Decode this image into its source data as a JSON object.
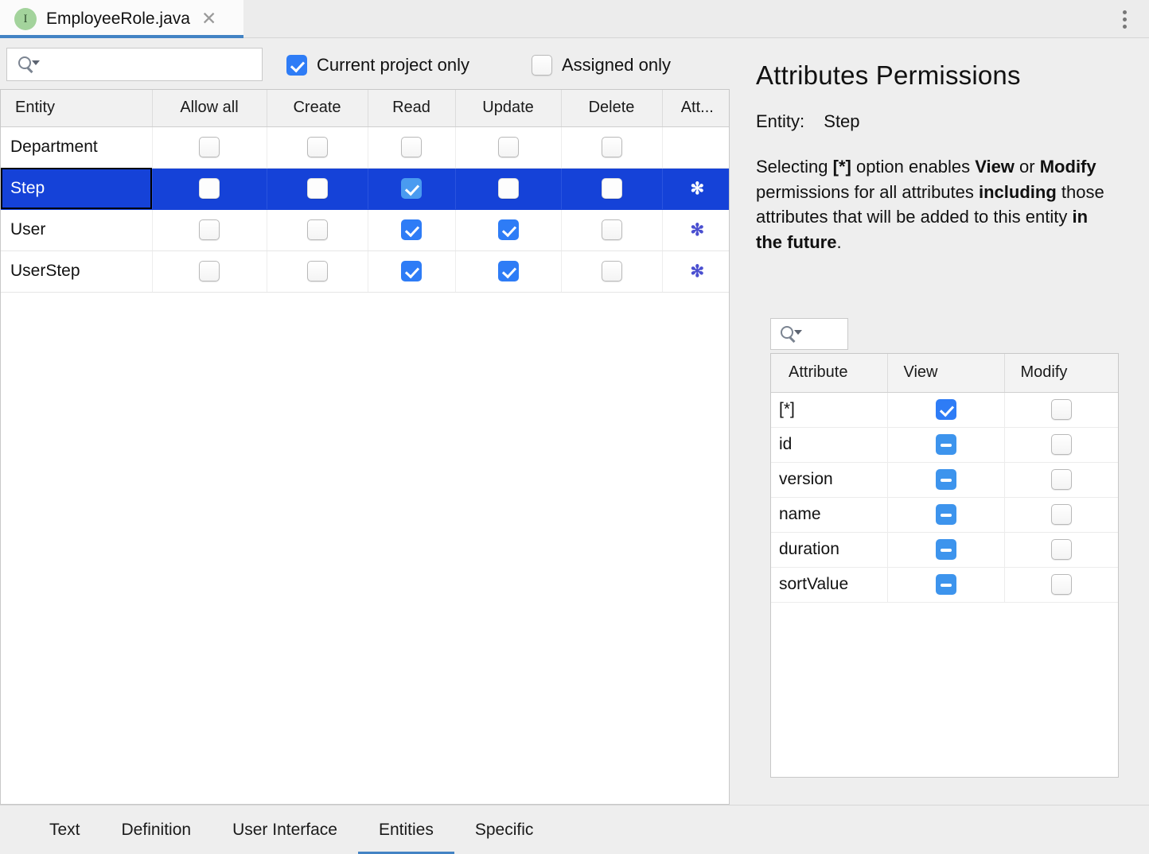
{
  "editor_tab": {
    "icon": "java-interface-icon",
    "filename": "EmployeeRole.java",
    "close": "✕"
  },
  "window_menu": {
    "icon": "more-vertical-icon"
  },
  "filters": {
    "search": {
      "placeholder": "",
      "value": "",
      "icon": "search-icon"
    },
    "current_project_only": {
      "label": "Current project only",
      "checked": true
    },
    "assigned_only": {
      "label": "Assigned only",
      "checked": false
    }
  },
  "entities_table": {
    "columns": [
      "Entity",
      "Allow all",
      "Create",
      "Read",
      "Update",
      "Delete",
      "Att..."
    ],
    "rows": [
      {
        "entity": "Department",
        "selected": false,
        "allow_all": "off",
        "create": "off",
        "read": "off",
        "update": "off",
        "delete": "off",
        "attributes": ""
      },
      {
        "entity": "Step",
        "selected": true,
        "allow_all": "off",
        "create": "off",
        "read": "on",
        "update": "off",
        "delete": "off",
        "attributes": "✻"
      },
      {
        "entity": "User",
        "selected": false,
        "allow_all": "off",
        "create": "off",
        "read": "on",
        "update": "on",
        "delete": "off",
        "attributes": "✻"
      },
      {
        "entity": "UserStep",
        "selected": false,
        "allow_all": "off",
        "create": "off",
        "read": "on",
        "update": "on",
        "delete": "off",
        "attributes": "✻"
      }
    ]
  },
  "attributes_panel": {
    "title": "Attributes Permissions",
    "entity_label": "Entity:",
    "entity_value": "Step",
    "description_parts": [
      {
        "text": "Selecting ",
        "bold": false
      },
      {
        "text": "[*]",
        "bold": true
      },
      {
        "text": " option enables ",
        "bold": false
      },
      {
        "text": "View",
        "bold": true
      },
      {
        "text": " or ",
        "bold": false
      },
      {
        "text": "Modify",
        "bold": true
      },
      {
        "text": " permissions for all attributes ",
        "bold": false
      },
      {
        "text": "including",
        "bold": true
      },
      {
        "text": " those attributes that will be added to this entity ",
        "bold": false
      },
      {
        "text": "in the future",
        "bold": true
      },
      {
        "text": ".",
        "bold": false
      }
    ],
    "search": {
      "placeholder": "",
      "value": "",
      "icon": "search-icon"
    },
    "columns": [
      "Attribute",
      "View",
      "Modify"
    ],
    "rows": [
      {
        "attribute": "[*]",
        "view": "on",
        "modify": "off"
      },
      {
        "attribute": "id",
        "view": "dash",
        "modify": "off"
      },
      {
        "attribute": "version",
        "view": "dash",
        "modify": "off"
      },
      {
        "attribute": "name",
        "view": "dash",
        "modify": "off"
      },
      {
        "attribute": "duration",
        "view": "dash",
        "modify": "off"
      },
      {
        "attribute": "sortValue",
        "view": "dash",
        "modify": "off"
      }
    ]
  },
  "bottom_tabs": [
    {
      "label": "Text",
      "active": false
    },
    {
      "label": "Definition",
      "active": false
    },
    {
      "label": "User Interface",
      "active": false
    },
    {
      "label": "Entities",
      "active": true
    },
    {
      "label": "Specific",
      "active": false
    }
  ],
  "colors": {
    "accent_blue": "#2e7cf6",
    "selection_blue": "#1542d8",
    "tab_underline": "#4383c4",
    "asterisk": "#4a4fd0",
    "panel_bg": "#eeeeee"
  }
}
